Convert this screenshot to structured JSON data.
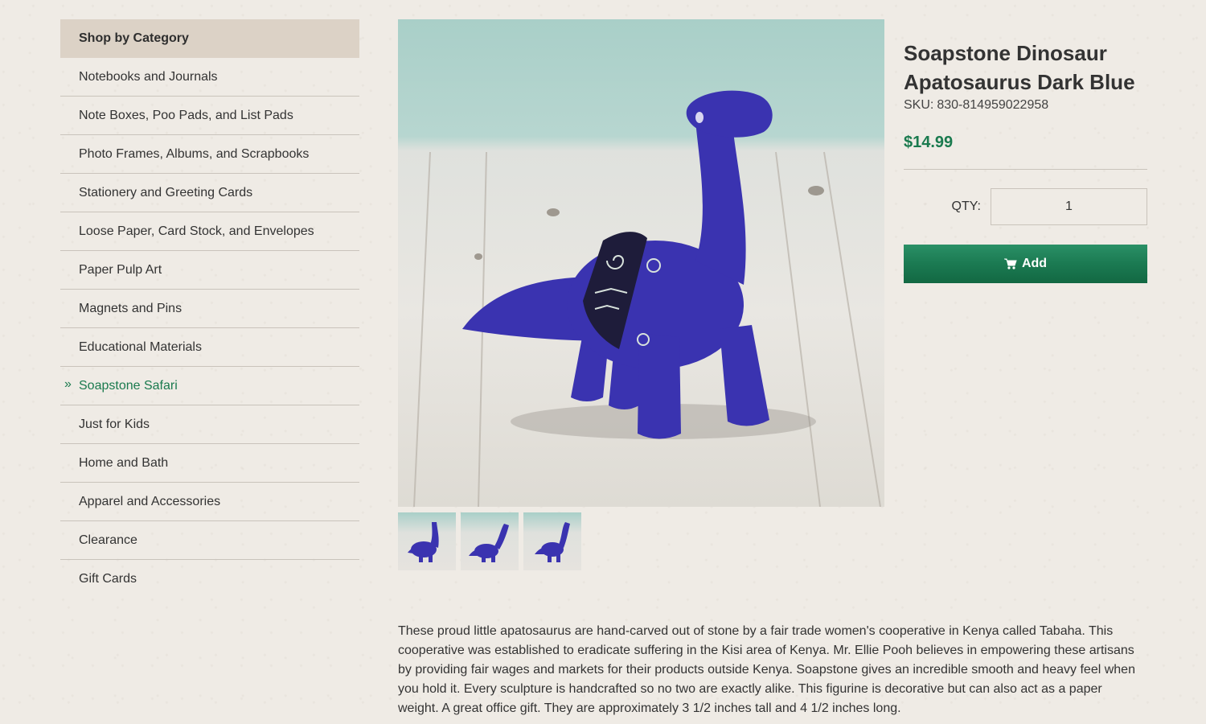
{
  "sidebar": {
    "heading": "Shop by Category",
    "items": [
      {
        "label": "Notebooks and Journals",
        "active": false
      },
      {
        "label": "Note Boxes, Poo Pads, and List Pads",
        "active": false
      },
      {
        "label": "Photo Frames, Albums, and Scrapbooks",
        "active": false
      },
      {
        "label": "Stationery and Greeting Cards",
        "active": false
      },
      {
        "label": "Loose Paper, Card Stock, and Envelopes",
        "active": false
      },
      {
        "label": "Paper Pulp Art",
        "active": false
      },
      {
        "label": "Magnets and Pins",
        "active": false
      },
      {
        "label": "Educational Materials",
        "active": false
      },
      {
        "label": "Soapstone Safari",
        "active": true
      },
      {
        "label": "Just for Kids",
        "active": false
      },
      {
        "label": "Home and Bath",
        "active": false
      },
      {
        "label": "Apparel and Accessories",
        "active": false
      },
      {
        "label": "Clearance",
        "active": false
      },
      {
        "label": "Gift Cards",
        "active": false
      }
    ],
    "active_marker": "»"
  },
  "product": {
    "title": "Soapstone Dinosaur Apatosaurus Dark Blue",
    "sku_label": "SKU:",
    "sku": "830-814959022958",
    "price": "$14.99",
    "qty_label": "QTY:",
    "qty_value": "1",
    "add_label": "Add",
    "add_icon": "cart-icon",
    "thumbnail_count": 3,
    "description": "These proud little apatosaurus are hand-carved out of stone by a fair trade women's cooperative in Kenya called Tabaha. This cooperative was established to eradicate suffering in the Kisi area of Kenya. Mr. Ellie Pooh believes in empowering these artisans by providing fair wages and markets for their products outside Kenya. Soapstone gives an incredible smooth and heavy feel when you hold it. Every sculpture is handcrafted so no two are exactly alike. This figurine is decorative but can also act as a paper weight. A great office gift. They are approximately 3 1/2 inches tall and 4 1/2 inches long."
  },
  "colors": {
    "accent": "#1a7a4e",
    "background": "#efebe5",
    "sidebar_header": "#dcd2c6",
    "dinosaur": "#3a33b0"
  }
}
